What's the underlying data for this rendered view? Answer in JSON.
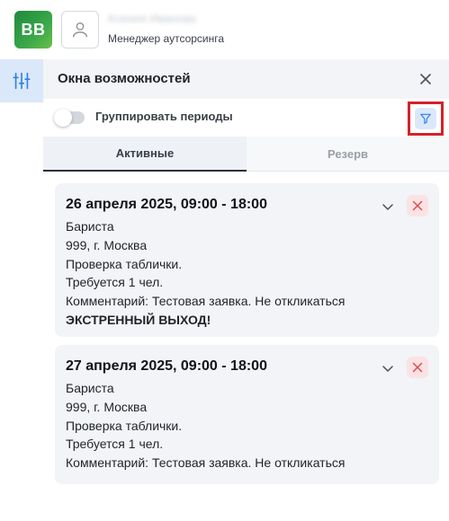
{
  "header": {
    "logo_text": "BB",
    "user_name": "Ксения Иванова",
    "user_role": "Менеджер аутсорсинга"
  },
  "panel": {
    "title": "Окна возможностей",
    "toggle_label": "Группировать периоды",
    "toggle_on": false
  },
  "tabs": [
    {
      "label": "Активные",
      "active": true
    },
    {
      "label": "Резерв",
      "active": false
    }
  ],
  "cards": [
    {
      "title": "26 апреля 2025, 09:00 - 18:00",
      "role": "Бариста",
      "address": "999, г. Москва",
      "description": "Проверка таблички.",
      "required": "Требуется 1 чел.",
      "comment": "Комментарий: Тестовая заявка. Не откликаться",
      "note": "ЭКСТРЕННЫЙ ВЫХОД!"
    },
    {
      "title": "27 апреля 2025, 09:00 - 18:00",
      "role": "Бариста",
      "address": "999, г. Москва",
      "description": "Проверка таблички.",
      "required": "Требуется 1 чел.",
      "comment": "Комментарий: Тестовая заявка. Не откликаться"
    }
  ],
  "colors": {
    "accent": "#2f80ed",
    "accent_bg": "#dbe8fa",
    "danger": "#e5484d",
    "danger_bg": "#fbe3e4",
    "highlight_frame": "#d6202a",
    "logo_green": "#2e9b45"
  },
  "icons": {
    "rail": "sliders-icon",
    "close": "close-icon",
    "filter": "filter-icon",
    "expand": "chevron-down-icon",
    "delete": "delete-x-icon",
    "avatar": "user-icon"
  }
}
